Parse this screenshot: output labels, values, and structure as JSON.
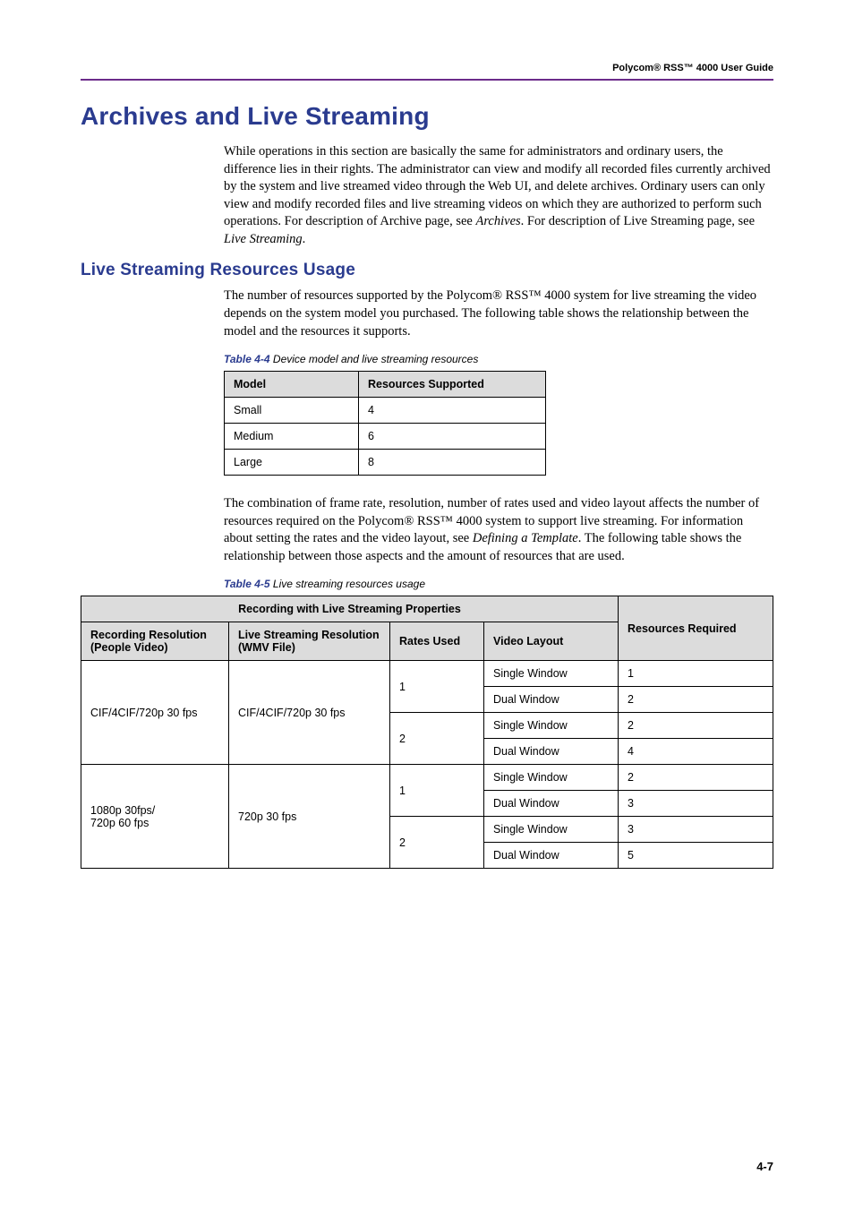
{
  "header": {
    "running_head": "Polycom® RSS™ 4000 User Guide"
  },
  "h1": "Archives and Live Streaming",
  "p1": "While operations in this section are basically the same for administrators and ordinary users, the difference lies in their rights. The administrator can view and modify all recorded files currently archived by the system and live streamed video through the Web UI, and delete archives. Ordinary users can only view and modify recorded files and live streaming videos on which they are authorized to perform such operations. For description of Archive page, see ",
  "p1_link1": "Archives",
  "p1_mid": ". For description of Live Streaming page, see ",
  "p1_link2": "Live Streaming",
  "p1_end": ".",
  "h2": "Live Streaming Resources Usage",
  "p2": "The number of resources supported by the Polycom® RSS™ 4000 system for live streaming the video depends on the system model you purchased. The following table shows the relationship between the model and the resources it supports.",
  "table44": {
    "caption_lead": "Table 4-4",
    "caption_rest": " Device model and live streaming resources",
    "headers": {
      "model": "Model",
      "res": "Resources Supported"
    },
    "rows": [
      {
        "model": "Small",
        "res": "4"
      },
      {
        "model": "Medium",
        "res": "6"
      },
      {
        "model": "Large",
        "res": "8"
      }
    ]
  },
  "p3_a": "The combination of frame rate, resolution, number of rates used and video layout affects the number of resources required on the Polycom® RSS™ 4000 system to support live streaming. For information about setting the rates and the video layout, see ",
  "p3_link": "Defining a Template",
  "p3_b": ". The following table shows the relationship between those aspects and the amount of resources that are used.",
  "table45": {
    "caption_lead": "Table 4-5",
    "caption_rest": " Live streaming resources usage",
    "top_header": "Recording with Live Streaming Properties",
    "headers": {
      "rec": "Recording Resolution\n(People Video)",
      "live": "Live Streaming Resolution\n(WMV File)",
      "rates": "Rates Used",
      "layout": "Video Layout",
      "req": "Resources Required"
    },
    "group1": {
      "rec": "CIF/4CIF/720p 30 fps",
      "live": "CIF/4CIF/720p 30 fps",
      "rows": [
        {
          "rates": "1",
          "layout": "Single Window",
          "req": "1"
        },
        {
          "layout": "Dual Window",
          "req": "2"
        },
        {
          "rates": "2",
          "layout": "Single Window",
          "req": "2"
        },
        {
          "layout": "Dual Window",
          "req": "4"
        }
      ]
    },
    "group2": {
      "rec": "1080p 30fps/\n720p 60 fps",
      "live": "720p 30 fps",
      "rows": [
        {
          "rates": "1",
          "layout": "Single Window",
          "req": "2"
        },
        {
          "layout": "Dual Window",
          "req": "3"
        },
        {
          "rates": "2",
          "layout": "Single Window",
          "req": "3"
        },
        {
          "layout": "Dual Window",
          "req": "5"
        }
      ]
    }
  },
  "page_number": "4-7"
}
